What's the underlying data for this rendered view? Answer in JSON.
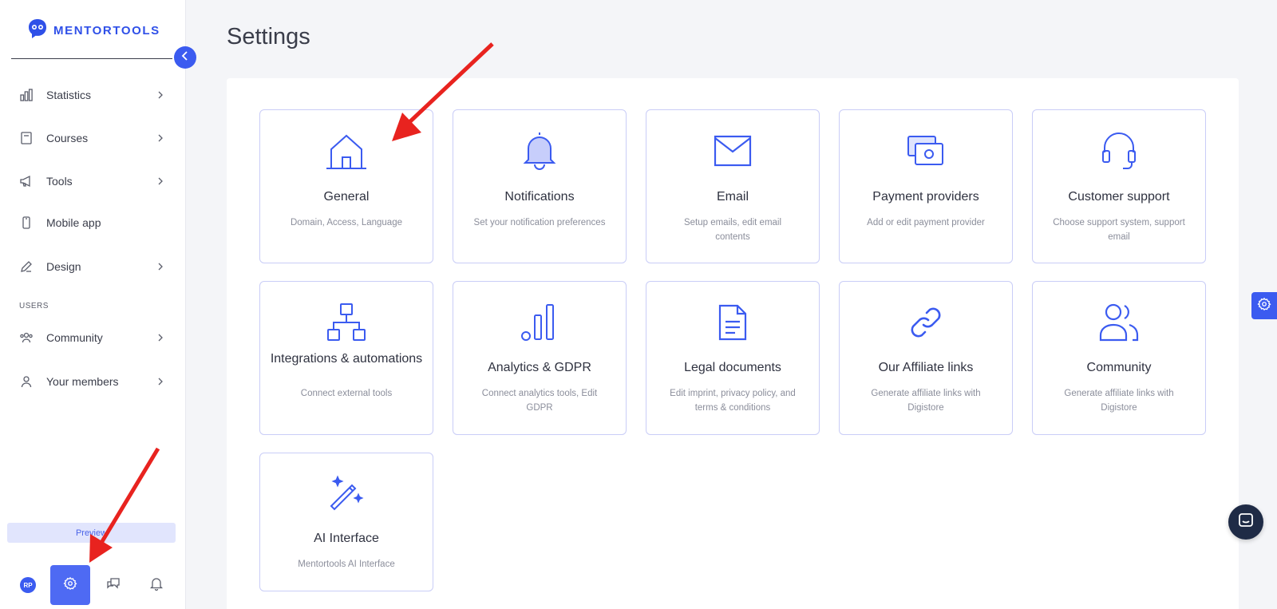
{
  "brand": {
    "name": "MENTORTOOLS",
    "accent": "#3b5bf0"
  },
  "sidebar": {
    "items": [
      {
        "label": "Statistics",
        "icon": "bar-chart-icon",
        "has_submenu": true
      },
      {
        "label": "Courses",
        "icon": "book-icon",
        "has_submenu": true
      },
      {
        "label": "Tools",
        "icon": "megaphone-icon",
        "has_submenu": true
      },
      {
        "label": "Mobile app",
        "icon": "phone-icon",
        "has_submenu": false
      },
      {
        "label": "Design",
        "icon": "pencil-icon",
        "has_submenu": true
      }
    ],
    "section_users": "USERS",
    "user_items": [
      {
        "label": "Community",
        "icon": "people-icon",
        "has_submenu": true
      },
      {
        "label": "Your members",
        "icon": "person-icon",
        "has_submenu": true
      }
    ],
    "preview_label": "Preview",
    "avatar_initials": "RP"
  },
  "page": {
    "title": "Settings"
  },
  "cards": [
    {
      "title": "General",
      "desc": "Domain, Access, Language",
      "icon": "house-icon"
    },
    {
      "title": "Notifications",
      "desc": "Set your notification preferences",
      "icon": "bell-icon"
    },
    {
      "title": "Email",
      "desc": "Setup emails, edit email contents",
      "icon": "envelope-icon"
    },
    {
      "title": "Payment providers",
      "desc": "Add or edit payment provider",
      "icon": "money-icon"
    },
    {
      "title": "Customer support",
      "desc": "Choose support system, support email",
      "icon": "headset-icon"
    },
    {
      "title": "Integrations & automations",
      "desc": "Connect external tools",
      "icon": "hierarchy-icon"
    },
    {
      "title": "Analytics & GDPR",
      "desc": "Connect analytics tools, Edit GDPR",
      "icon": "analytics-icon"
    },
    {
      "title": "Legal documents",
      "desc": "Edit imprint, privacy policy, and terms & conditions",
      "icon": "document-icon"
    },
    {
      "title": "Our Affiliate links",
      "desc": "Generate affiliate links with Digistore",
      "icon": "link-icon"
    },
    {
      "title": "Community",
      "desc": "Generate affiliate links with Digistore",
      "icon": "users-icon"
    },
    {
      "title": "AI Interface",
      "desc": "Mentortools AI Interface",
      "icon": "magic-wand-icon"
    }
  ],
  "colors": {
    "annotation_arrow": "#e8231f",
    "card_border": "#c9cdf7",
    "chat_button": "#1f2b46"
  }
}
